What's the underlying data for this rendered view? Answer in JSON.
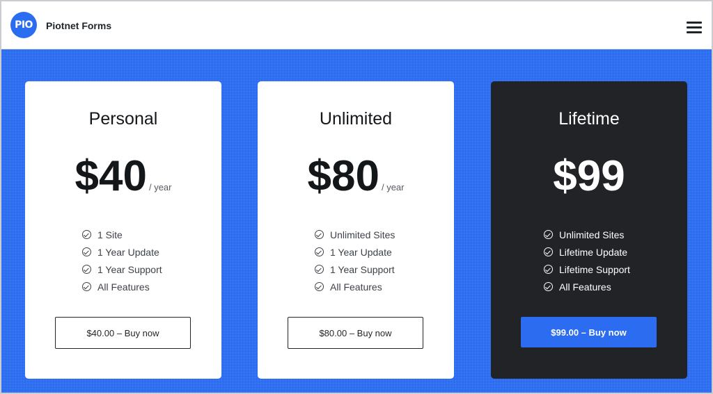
{
  "header": {
    "logo_text": "PIO",
    "brand": "Piotnet Forms",
    "menu_icon": "hamburger-icon"
  },
  "colors": {
    "accent": "#2b6cf0",
    "dark_card": "#212326",
    "text": "#14171a"
  },
  "plans": [
    {
      "name": "Personal",
      "price": "$40",
      "period": "/ year",
      "features": [
        "1 Site",
        "1 Year Update",
        "1 Year Support",
        "All Features"
      ],
      "button": "$40.00 – Buy now"
    },
    {
      "name": "Unlimited",
      "price": "$80",
      "period": "/ year",
      "features": [
        "Unlimited Sites",
        "1 Year Update",
        "1 Year Support",
        "All Features"
      ],
      "button": "$80.00 – Buy now"
    },
    {
      "name": "Lifetime",
      "price": "$99",
      "features": [
        "Unlimited Sites",
        "Lifetime Update",
        "Lifetime Support",
        "All Features"
      ],
      "button": "$99.00 – Buy now"
    }
  ]
}
